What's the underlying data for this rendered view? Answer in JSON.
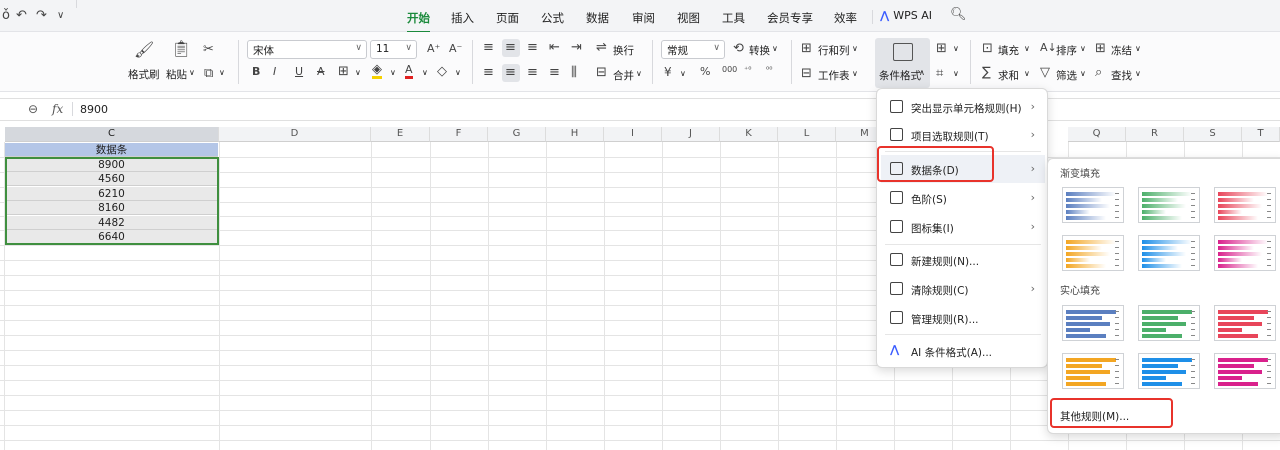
{
  "menu_tabs": [
    "开始",
    "插入",
    "页面",
    "公式",
    "数据",
    "审阅",
    "视图",
    "工具",
    "会员专享",
    "效率"
  ],
  "active_tab": "开始",
  "wps_ai_label": "WPS AI",
  "ribbon": {
    "format_painter": "格式刷",
    "paste": "粘贴",
    "font_name": "宋体",
    "font_size": "11",
    "wrap": "换行",
    "merge": "合并",
    "number_format": "常规",
    "convert": "转换",
    "row_col": "行和列",
    "worksheet": "工作表",
    "cond_format": "条件格式",
    "fill": "填充",
    "sort": "排序",
    "freeze": "冻结",
    "sum": "求和",
    "filter": "筛选",
    "find": "查找"
  },
  "formula_bar": {
    "fx": "fx",
    "value": "8900"
  },
  "columns": [
    "C",
    "D",
    "E",
    "F",
    "G",
    "H",
    "I",
    "J",
    "K",
    "L",
    "M",
    "Q",
    "R",
    "S",
    "T"
  ],
  "sheet": {
    "header": "数据条",
    "values": [
      "8900",
      "4560",
      "6210",
      "8160",
      "4482",
      "6640"
    ]
  },
  "dropdown_items": [
    {
      "label": "突出显示单元格规则(H)",
      "submenu": true
    },
    {
      "label": "项目选取规则(T)",
      "submenu": true
    },
    {
      "label": "数据条(D)",
      "submenu": true
    },
    {
      "label": "色阶(S)",
      "submenu": true
    },
    {
      "label": "图标集(I)",
      "submenu": true
    },
    {
      "label": "新建规则(N)...",
      "submenu": false
    },
    {
      "label": "清除规则(C)",
      "submenu": true
    },
    {
      "label": "管理规则(R)...",
      "submenu": false
    },
    {
      "label": "AI 条件格式(A)...",
      "submenu": false
    }
  ],
  "submenu": {
    "gradient_title": "渐变填充",
    "solid_title": "实心填充",
    "other_rules": "其他规则(M)...",
    "colors": [
      "#5b7fc0",
      "#4caf6a",
      "#e8455a",
      "#f3a623",
      "#1e8fe8",
      "#d9218c"
    ]
  },
  "highlight_color": "#e8332b",
  "accent_color": "#1b8a3c"
}
